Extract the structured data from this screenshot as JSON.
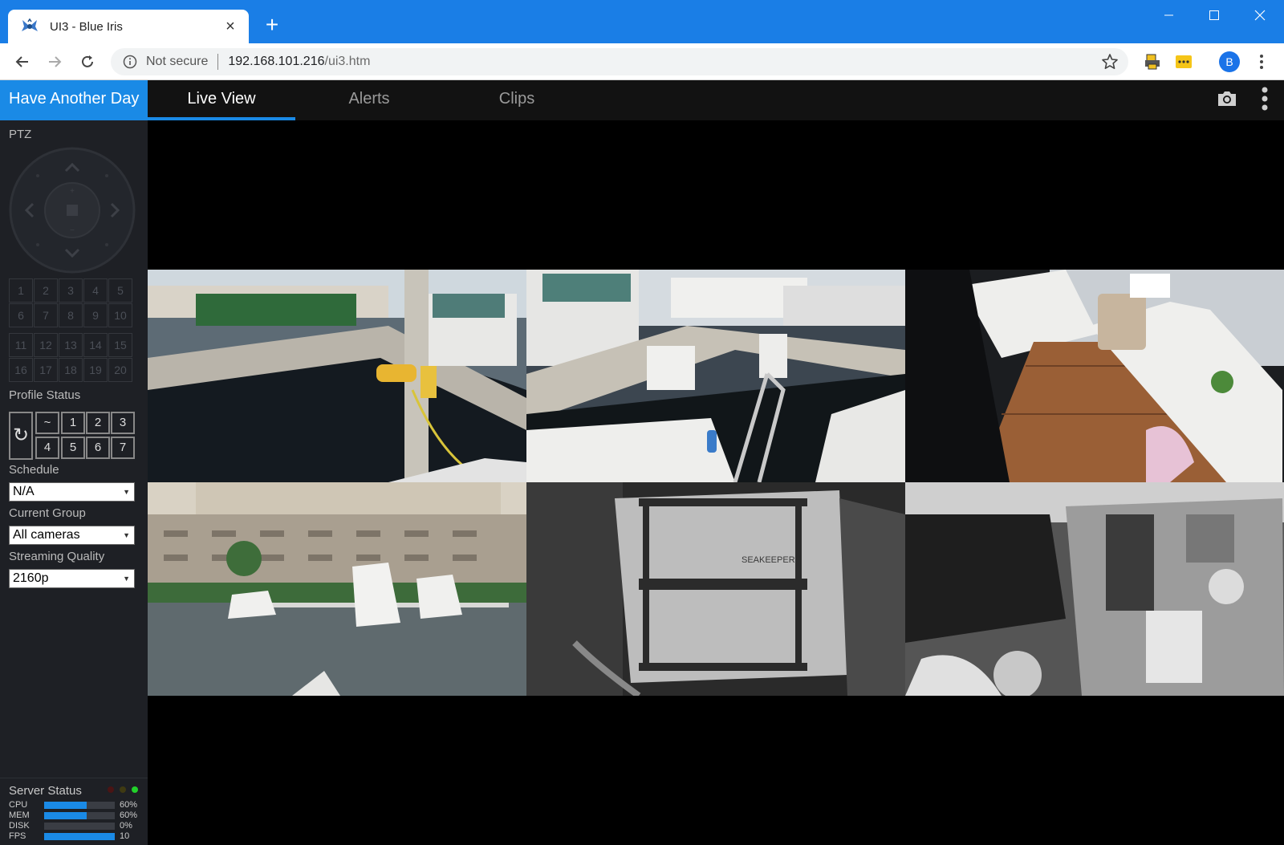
{
  "browser": {
    "tab_title": "UI3 - Blue Iris",
    "address": {
      "security": "Not secure",
      "host": "192.168.101.216",
      "path": "/ui3.htm"
    },
    "profile_initial": "B"
  },
  "app": {
    "server_name": "Have Another Day",
    "tabs": [
      {
        "label": "Live View",
        "active": true
      },
      {
        "label": "Alerts",
        "active": false
      },
      {
        "label": "Clips",
        "active": false
      }
    ],
    "accent_color": "#1a8ae6"
  },
  "sidebar": {
    "ptz_label": "PTZ",
    "presets": [
      "1",
      "2",
      "3",
      "4",
      "5",
      "6",
      "7",
      "8",
      "9",
      "10",
      "11",
      "12",
      "13",
      "14",
      "15",
      "16",
      "17",
      "18",
      "19",
      "20"
    ],
    "profile_status_label": "Profile Status",
    "profile_buttons": [
      "~",
      "1",
      "2",
      "3",
      "4",
      "5",
      "6",
      "7"
    ],
    "schedule_label": "Schedule",
    "schedule_value": "N/A",
    "current_group_label": "Current Group",
    "current_group_value": "All cameras",
    "streaming_quality_label": "Streaming Quality",
    "streaming_quality_value": "2160p",
    "server_status": {
      "label": "Server Status",
      "rows": [
        {
          "name": "CPU",
          "value": "60%",
          "fraction": 0.6
        },
        {
          "name": "MEM",
          "value": "60%",
          "fraction": 0.6
        },
        {
          "name": "DISK",
          "value": "0%",
          "fraction": 0.0
        },
        {
          "name": "FPS",
          "value": "10",
          "fraction": 1.0
        }
      ]
    }
  },
  "cameras": [
    {
      "scene": "marina-dock-color"
    },
    {
      "scene": "marina-pier-color"
    },
    {
      "scene": "boat-deck-color"
    },
    {
      "scene": "marina-buildings-color"
    },
    {
      "scene": "engine-room-night"
    },
    {
      "scene": "engine-room-night-2"
    }
  ],
  "camera_overlay_text": "SEAKEEPER"
}
